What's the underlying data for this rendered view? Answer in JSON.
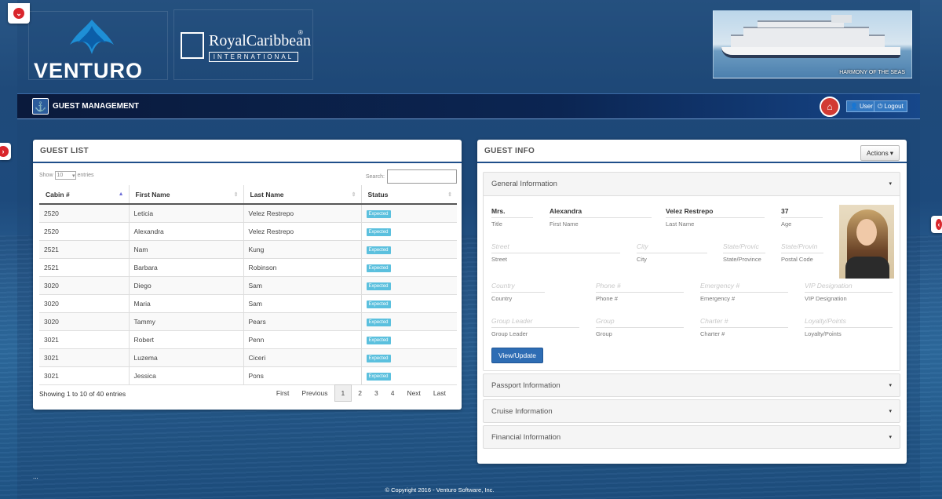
{
  "brand": {
    "venturo": "VENTURO",
    "rc_name": "RoyalCaribbean",
    "rc_reg": "®",
    "rc_intl": "INTERNATIONAL",
    "ship_caption": "HARMONY OF THE SEAS"
  },
  "nav": {
    "title": "GUEST MANAGEMENT",
    "user": "User",
    "logout": "Logout"
  },
  "guest_list": {
    "title": "GUEST LIST",
    "show_label": "Show",
    "page_size": "10",
    "entries_label": "entries",
    "search_label": "Search:",
    "search_value": "",
    "columns": [
      "Cabin #",
      "First Name",
      "Last Name",
      "Status"
    ],
    "rows": [
      {
        "cabin": "2520",
        "first": "Leticia",
        "last": "Velez Restrepo",
        "status": "Expected"
      },
      {
        "cabin": "2520",
        "first": "Alexandra",
        "last": "Velez Restrepo",
        "status": "Expected"
      },
      {
        "cabin": "2521",
        "first": "Nam",
        "last": "Kung",
        "status": "Expected"
      },
      {
        "cabin": "2521",
        "first": "Barbara",
        "last": "Robinson",
        "status": "Expected"
      },
      {
        "cabin": "3020",
        "first": "Diego",
        "last": "Sam",
        "status": "Expected"
      },
      {
        "cabin": "3020",
        "first": "Maria",
        "last": "Sam",
        "status": "Expected"
      },
      {
        "cabin": "3020",
        "first": "Tammy",
        "last": "Pears",
        "status": "Expected"
      },
      {
        "cabin": "3021",
        "first": "Robert",
        "last": "Penn",
        "status": "Expected"
      },
      {
        "cabin": "3021",
        "first": "Luzema",
        "last": "Ciceri",
        "status": "Expected"
      },
      {
        "cabin": "3021",
        "first": "Jessica",
        "last": "Pons",
        "status": "Expected"
      }
    ],
    "summary": "Showing 1 to 10 of 40 entries",
    "pager": {
      "first": "First",
      "previous": "Previous",
      "pages": [
        "1",
        "2",
        "3",
        "4"
      ],
      "next": "Next",
      "last": "Last",
      "current": "1"
    }
  },
  "guest_info": {
    "title": "GUEST INFO",
    "actions": "Actions",
    "general": {
      "heading": "General Information",
      "title_value": "Mrs.",
      "title_label": "Title",
      "first_value": "Alexandra",
      "first_label": "First Name",
      "last_value": "Velez Restrepo",
      "last_label": "Last Name",
      "age_value": "37",
      "age_label": "Age",
      "street_ph": "Street",
      "street_label": "Street",
      "city_ph": "City",
      "city_label": "City",
      "state_ph": "State/Provic",
      "state_label": "State/Province",
      "postal_ph": "State/Provin",
      "postal_label": "Postal Code",
      "country_ph": "Country",
      "country_label": "Country",
      "phone_ph": "Phone #",
      "phone_label": "Phone #",
      "emergency_ph": "Emergency #",
      "emergency_label": "Emergency #",
      "vip_ph": "VIP Designation",
      "vip_label": "VIP Designation",
      "group_leader_ph": "Group Leader",
      "group_leader_label": "Group Leader",
      "group_ph": "Group",
      "group_label": "Group",
      "charter_ph": "Charter #",
      "charter_label": "Charter #",
      "loyalty_ph": "Loyalty/Points",
      "loyalty_label": "Loyalty/Points",
      "view_update": "View/Update"
    },
    "passport": "Passport Information",
    "cruise": "Cruise Information",
    "financial": "Financial Information"
  },
  "footer": {
    "dots": "...",
    "copyright": "© Copyright 2016 - Venturo Software, Inc."
  },
  "colors": {
    "accent": "#1f4f8a",
    "badge": "#5bc0de",
    "home": "#d23a33",
    "button": "#2e6db4"
  }
}
